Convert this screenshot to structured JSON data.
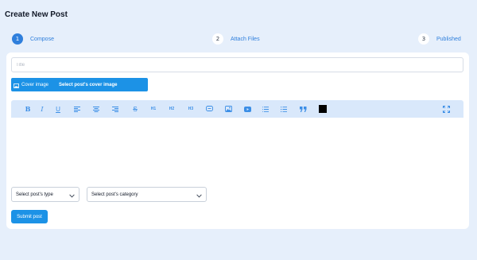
{
  "page": {
    "title": "Create New Post"
  },
  "stepper": {
    "steps": [
      {
        "number": "1",
        "label": "Compose",
        "active": true
      },
      {
        "number": "2",
        "label": "Attach Files",
        "active": false
      },
      {
        "number": "3",
        "label": "Published",
        "active": false
      }
    ]
  },
  "form": {
    "title_placeholder": "Title",
    "title_value": "",
    "cover_button_label": "Cover image",
    "cover_hint": "Select post's cover image",
    "type_select_value": "Select post's type",
    "category_select_value": "Select post's category",
    "submit_label": "Submit post"
  },
  "toolbar": {
    "heading1_label": "H1",
    "heading2_label": "H2",
    "heading3_label": "H3",
    "text_color": "#000000",
    "icons": [
      "bold-icon",
      "italic-icon",
      "underline-icon",
      "align-left-icon",
      "align-center-icon",
      "align-right-icon",
      "strikethrough-icon",
      "h1",
      "h2",
      "h3",
      "link-icon",
      "image-icon",
      "video-icon",
      "ordered-list-icon",
      "bullet-list-icon",
      "quote-icon",
      "color-swatch",
      "fullscreen-icon"
    ]
  },
  "colors": {
    "accent": "#1c92e6",
    "step_active": "#2f7fdc",
    "toolbar_bg": "#d9e8fb",
    "page_bg": "#e6effb"
  }
}
